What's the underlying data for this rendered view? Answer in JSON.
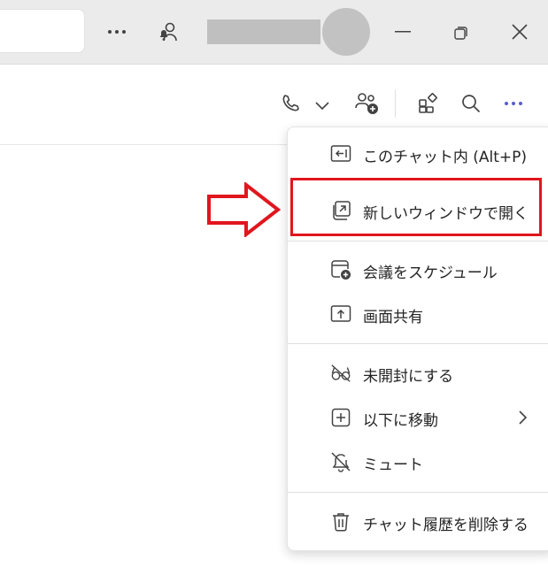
{
  "titlebar": {
    "icons": [
      "more-horizontal-icon",
      "notification-person-icon",
      "minimize-icon",
      "restore-icon",
      "close-icon"
    ]
  },
  "header": {
    "icons": [
      "phone-icon",
      "chevron-down-icon",
      "add-people-icon",
      "apps-icon",
      "search-icon",
      "more-horizontal-icon"
    ],
    "accent": "#5b5fc7"
  },
  "menu": {
    "items": [
      {
        "label": "このチャット内 (Alt+P)",
        "icon": "panel-left-icon"
      },
      {
        "label": "新しいウィンドウで開く",
        "icon": "open-new-window-icon"
      },
      {
        "label": "会議をスケジュール",
        "icon": "calendar-add-icon"
      },
      {
        "label": "画面共有",
        "icon": "share-screen-icon"
      },
      {
        "label": "未開封にする",
        "icon": "glasses-off-icon"
      },
      {
        "label": "以下に移動",
        "icon": "add-square-icon"
      },
      {
        "label": "ミュート",
        "icon": "bell-off-icon"
      },
      {
        "label": "チャット履歴を削除する",
        "icon": "trash-icon"
      }
    ]
  },
  "annotation": {
    "highlight_color": "#e0161e"
  }
}
